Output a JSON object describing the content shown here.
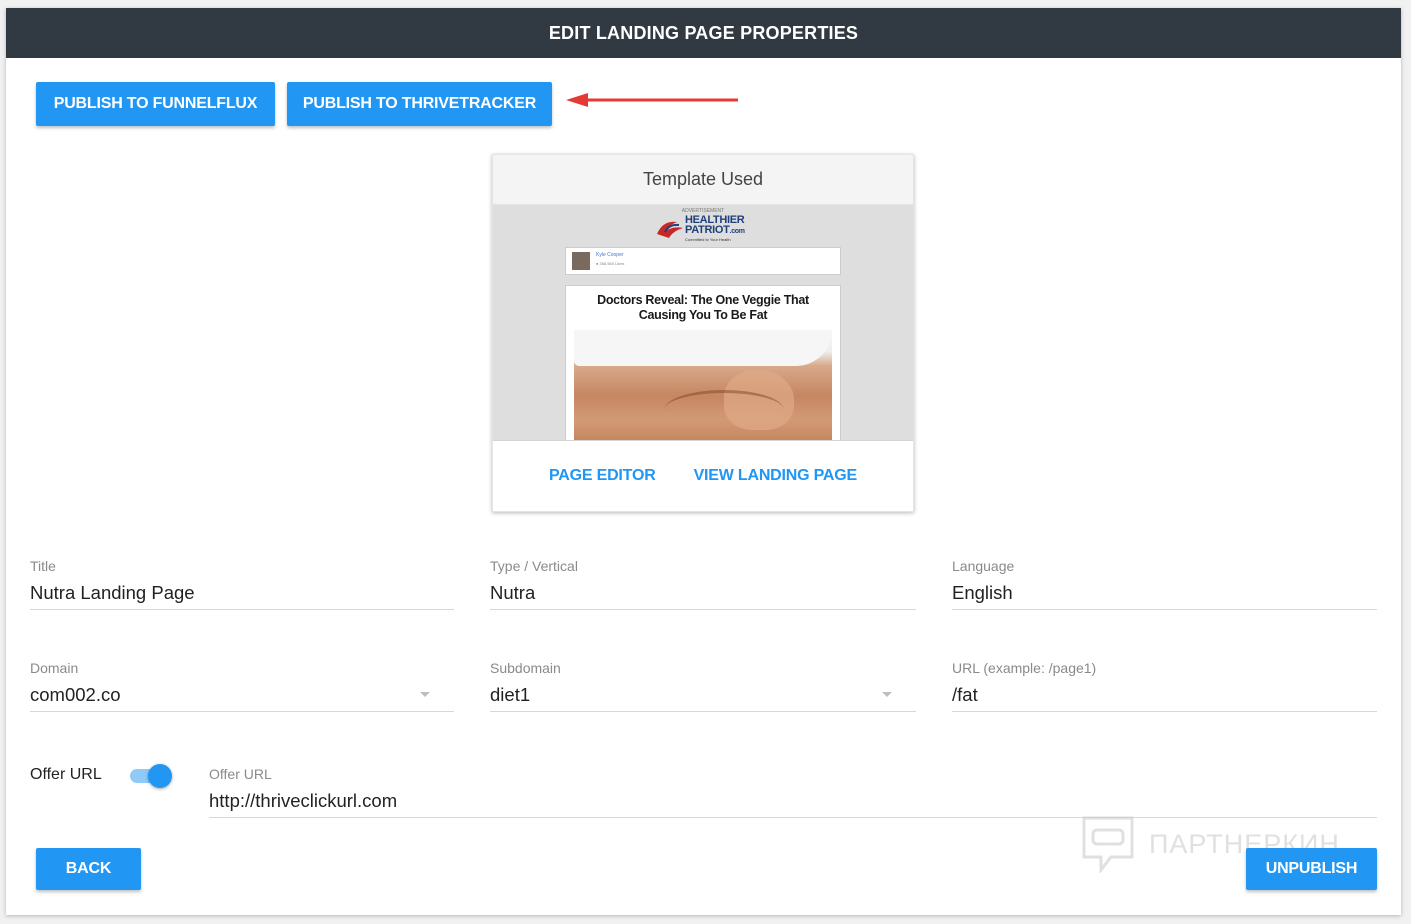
{
  "header": {
    "title": "EDIT LANDING PAGE PROPERTIES"
  },
  "actions": {
    "publish_funnelflux": "PUBLISH TO FUNNELFLUX",
    "publish_thrivetracker": "PUBLISH TO THRIVETRACKER"
  },
  "template": {
    "title": "Template Used",
    "preview": {
      "advertisement": "ADVERTISEMENT",
      "logo_line1": "HEALTHIER",
      "logo_line2": "PATRIOT",
      "logo_suffix": ".com",
      "logo_tagline": "Committed to Your Health",
      "author": "Kyle Cooper",
      "author_meta": "● 358,560 Likes",
      "headline": "Doctors Reveal: The One Veggie That Causing You To Be Fat"
    },
    "page_editor": "PAGE EDITOR",
    "view_landing_page": "VIEW LANDING PAGE"
  },
  "form": {
    "title": {
      "label": "Title",
      "value": "Nutra Landing Page"
    },
    "type": {
      "label": "Type / Vertical",
      "value": "Nutra"
    },
    "language": {
      "label": "Language",
      "value": "English"
    },
    "domain": {
      "label": "Domain",
      "value": "com002.co"
    },
    "subdomain": {
      "label": "Subdomain",
      "value": "diet1"
    },
    "url": {
      "label": "URL (example: /page1)",
      "value": "/fat"
    },
    "offer_toggle": {
      "label": "Offer URL",
      "enabled": true
    },
    "offer_url": {
      "label": "Offer URL",
      "value": "http://thriveclickurl.com"
    }
  },
  "footer": {
    "back": "BACK",
    "unpublish": "UNPUBLISH"
  },
  "watermark": {
    "text": "ПАРТНЕРКИН"
  },
  "colors": {
    "header_bg": "#313a42",
    "accent": "#2196f3",
    "arrow": "#e53935",
    "toggle_track": "#90caf9"
  }
}
